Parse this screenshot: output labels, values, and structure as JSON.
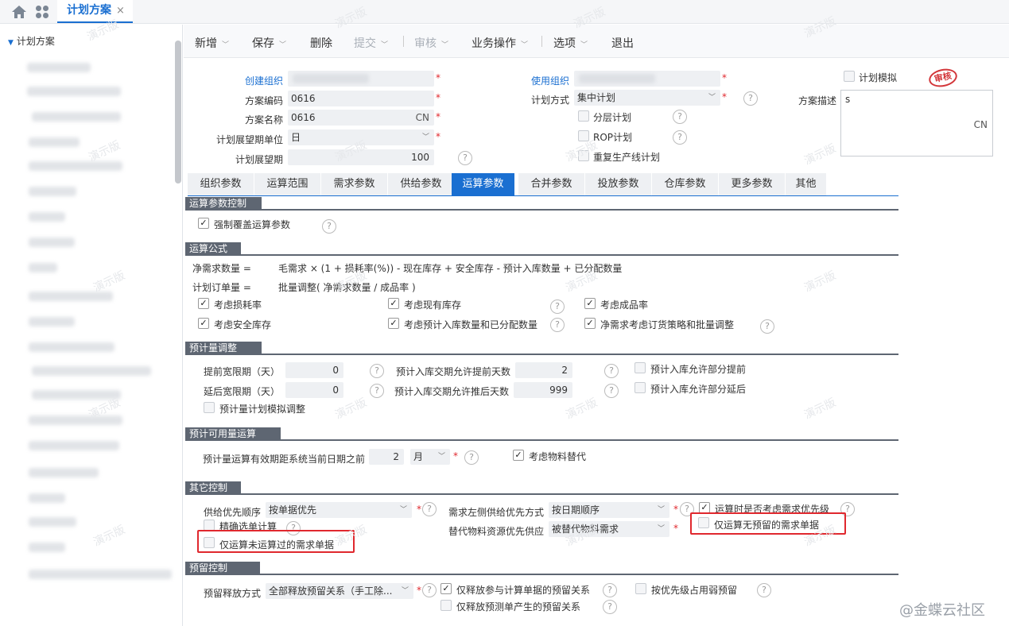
{
  "topbar": {
    "tab_label": "计划方案",
    "tab_close": "×"
  },
  "tree": {
    "root_label": "计划方案",
    "root_arrow": "▼"
  },
  "toolbar": {
    "items": [
      {
        "label": "新增",
        "chev": "﹀"
      },
      {
        "label": "保存",
        "chev": "﹀"
      },
      {
        "label": "删除",
        "chev": ""
      },
      {
        "label": "提交",
        "chev": "﹀"
      },
      {
        "label": "审核",
        "chev": "﹀"
      },
      {
        "label": "业务操作",
        "chev": "﹀"
      },
      {
        "label": "选项",
        "chev": "﹀"
      },
      {
        "label": "退出",
        "chev": ""
      }
    ]
  },
  "form": {
    "create_org_label": "创建组织",
    "use_org_label": "使用组织",
    "plan_code_label": "方案编码",
    "plan_code_value": "0616",
    "plan_name_label": "方案名称",
    "plan_name_value": "0616",
    "plan_name_suffix": "CN",
    "horizon_unit_label": "计划展望期单位",
    "horizon_unit_value": "日",
    "horizon_label": "计划展望期",
    "horizon_value": "100",
    "plan_method_label": "计划方式",
    "plan_method_value": "集中计划",
    "layered_label": "分层计划",
    "rop_label": "ROP计划",
    "repeat_label": "重复生产线计划",
    "simulate_label": "计划模拟",
    "desc_label": "方案描述",
    "desc_value": "s",
    "desc_suffix": "CN",
    "stamp": "审核",
    "required": "*",
    "help": "?",
    "select_arrow": "﹀"
  },
  "param_tabs": [
    "组织参数",
    "运算范围",
    "需求参数",
    "供给参数",
    "运算参数",
    "合并参数",
    "投放参数",
    "仓库参数",
    "更多参数",
    "其他"
  ],
  "sections": {
    "ctrl": {
      "title": "运算参数控制",
      "force_label": "强制覆盖运算参数"
    },
    "formula": {
      "title": "运算公式",
      "net_label": "净需求数量 =",
      "net_expr": "毛需求 × (1 + 损耗率(%)) - 现在库存 + 安全库存 - 预计入库数量 + 已分配数量",
      "order_label": "计划订单量 =",
      "order_expr": "批量调整( 净需求数量 / 成品率 )",
      "loss": "考虑损耗率",
      "stock": "考虑现有库存",
      "yield": "考虑成品率",
      "safety": "考虑安全库存",
      "incoming": "考虑预计入库数量和已分配数量",
      "net_policy": "净需求考虑订货策略和批量调整"
    },
    "adjust": {
      "title": "预计量调整",
      "early_label": "提前宽限期（天）",
      "early_value": "0",
      "late_label": "延后宽限期（天）",
      "late_value": "0",
      "allow_early_days_label": "预计入库交期允许提前天数",
      "allow_early_days_value": "2",
      "allow_late_days_label": "预计入库交期允许推后天数",
      "allow_late_days_value": "999",
      "partial_early": "预计入库允许部分提前",
      "partial_late": "预计入库允许部分延后",
      "sim_adjust": "预计量计划模拟调整"
    },
    "avail": {
      "title": "预计可用量运算",
      "expiry_label": "预计量运算有效期距系统当前日期之前",
      "expiry_value": "2",
      "expiry_unit": "月",
      "substitute": "考虑物料替代"
    },
    "other": {
      "title": "其它控制",
      "supply_order_label": "供给优先顺序",
      "supply_order_value": "按单据优先",
      "demand_left_label": "需求左侧供给优先方式",
      "demand_left_value": "按日期顺序",
      "priority": "运算时是否考虑需求优先级",
      "exact_pick": "精确选单计算",
      "sub_resource_label": "替代物料资源优先供应",
      "sub_resource_value": "被替代物料需求",
      "only_unreserved": "仅运算无预留的需求单据",
      "only_uncomputed": "仅运算未运算过的需求单据"
    },
    "reserve": {
      "title": "预留控制",
      "release_label": "预留释放方式",
      "release_value": "全部释放预留关系（手工除...",
      "only_participate": "仅释放参与计算单据的预留关系",
      "by_priority": "按优先级占用弱预留",
      "only_forecast": "仅释放预测单产生的预留关系"
    }
  },
  "watermark": "演示版",
  "community": "@金蝶云社区",
  "check_mark": "✓"
}
